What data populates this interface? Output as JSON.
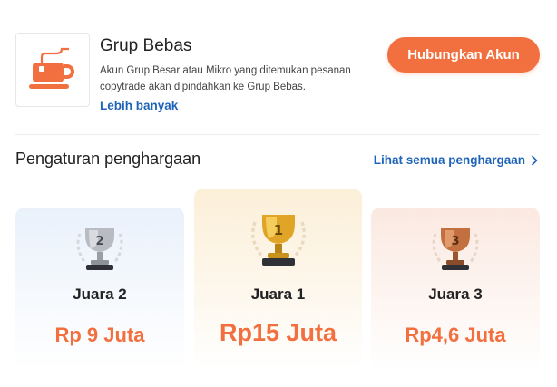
{
  "group": {
    "title": "Grup Bebas",
    "description": "Akun Grup Besar atau Mikro yang ditemukan pesanan copytrade akan dipindahkan ke Grup Bebas.",
    "more_link": "Lebih banyak",
    "connect_button": "Hubungkan Akun",
    "logo_icon": "teacup-icon"
  },
  "awards": {
    "section_title": "Pengaturan penghargaan",
    "see_all": "Lihat semua penghargaan",
    "items": [
      {
        "rank_number": "2",
        "label": "Juara 2",
        "prize": "Rp 9 Juta",
        "medal": "silver"
      },
      {
        "rank_number": "1",
        "label": "Juara 1",
        "prize": "Rp15 Juta",
        "medal": "gold"
      },
      {
        "rank_number": "3",
        "label": "Juara 3",
        "prize": "Rp4,6 Juta",
        "medal": "bronze"
      }
    ]
  },
  "colors": {
    "accent": "#f2703f",
    "link": "#1f64b8",
    "silver": "#b8bcc2",
    "gold": "#e0a526",
    "bronze": "#c2703f"
  }
}
